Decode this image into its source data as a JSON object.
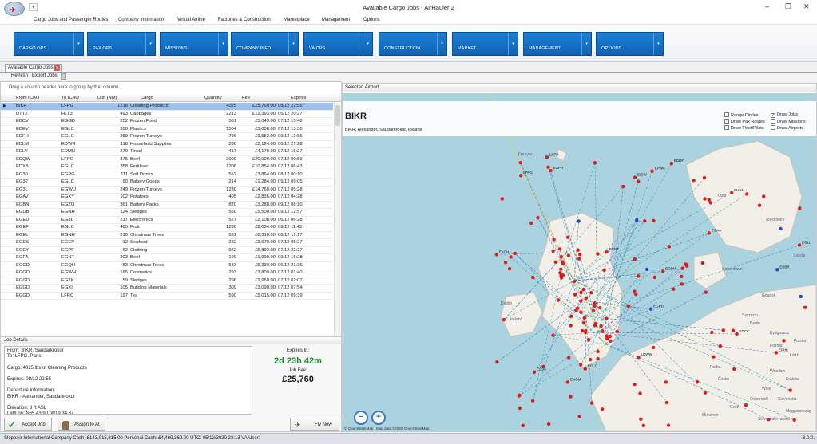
{
  "window": {
    "title": "Available Cargo Jobs - AirHauler 2",
    "qat_glyph": "▾",
    "orb_glyph": "✈",
    "controls": {
      "minimize": "–",
      "maximize": "❐",
      "close": "✕"
    }
  },
  "menubar": [
    "Cargo Jobs and Passenger Routes",
    "Company Information",
    "Virtual Airline",
    "Factories & Construction",
    "Marketplace",
    "Management",
    "Options"
  ],
  "ribbon": [
    "CARGO OPS",
    "PAX OPS",
    "MISSIONS",
    "COMPANY INFO",
    "VA OPS",
    "CONSTRUCTION",
    "MARKET",
    "MANAGEMENT",
    "OPTIONS"
  ],
  "ribbon_drop": "▾",
  "document_tab": {
    "label": "Available Cargo Jobs",
    "close": "x"
  },
  "toolbar": {
    "refresh": "Refresh",
    "export": "Export Jobs"
  },
  "grid": {
    "group_hint": "Drag a column header here to group by that column",
    "headers": {
      "from": "From ICAO",
      "to": "To ICAO",
      "dist": "Dist (NM)",
      "cargo": "Cargo",
      "qty": "Quantity",
      "fee": "Fee",
      "expires": "Expires"
    },
    "row_indicator": "▶",
    "rows": [
      {
        "from": "BIKR",
        "to": "LFPG",
        "dist": "1218",
        "cargo": "Cleaning Products",
        "qty": "4025",
        "fee": "£25,760.00",
        "exp": "08/12 22:55"
      },
      {
        "from": "DTTZ",
        "to": "HLT3",
        "dist": "493",
        "cargo": "Cabbages",
        "qty": "2213",
        "fee": "£12,393.00",
        "exp": "06/12 20:27"
      },
      {
        "from": "EBCV",
        "to": "EGGD",
        "dist": "252",
        "cargo": "Frozen Food",
        "qty": "561",
        "fee": "£5,049.00",
        "exp": "07/12 15:48"
      },
      {
        "from": "EDEV",
        "to": "EGLC",
        "dist": "330",
        "cargo": "Plastics",
        "qty": "1504",
        "fee": "£3,008.00",
        "exp": "07/12 13:30"
      },
      {
        "from": "EDFH",
        "to": "EGLC",
        "dist": "289",
        "cargo": "Frozen Turkeys",
        "qty": "796",
        "fee": "£9,552.00",
        "exp": "09/12 13:55"
      },
      {
        "from": "EDLM",
        "to": "EDWR",
        "dist": "118",
        "cargo": "Household Supplies",
        "qty": "236",
        "fee": "£2,124.00",
        "exp": "06/12 21:28"
      },
      {
        "from": "EDLV",
        "to": "EDMN",
        "dist": "270",
        "cargo": "Tinsel",
        "qty": "417",
        "fee": "£4,170.00",
        "exp": "07/12 15:27"
      },
      {
        "from": "EDQW",
        "to": "LFPG",
        "dist": "375",
        "cargo": "Beef",
        "qty": "2009",
        "fee": "£20,090.00",
        "exp": "07/12 00:59"
      },
      {
        "from": "EDXB",
        "to": "EGLC",
        "dist": "358",
        "cargo": "Fertiliser",
        "qty": "1206",
        "fee": "£10,854.00",
        "exp": "07/12 06:43"
      },
      {
        "from": "EG30",
        "to": "EGPG",
        "dist": "111",
        "cargo": "Soft Drinks",
        "qty": "552",
        "fee": "£3,864.00",
        "exp": "08/12 00:10"
      },
      {
        "from": "EG32",
        "to": "EGLC",
        "dist": "90",
        "cargo": "Bakery Goods",
        "qty": "214",
        "fee": "£1,284.00",
        "exp": "09/12 09:05"
      },
      {
        "from": "EG3L",
        "to": "EGWU",
        "dist": "249",
        "cargo": "Frozen Turkeys",
        "qty": "1230",
        "fee": "£14,760.00",
        "exp": "07/12 05:28"
      },
      {
        "from": "EGAV",
        "to": "EGXY",
        "dist": "102",
        "cargo": "Potatoes",
        "qty": "405",
        "fee": "£2,835.00",
        "exp": "07/12 04:28"
      },
      {
        "from": "EGBN",
        "to": "EGZQ",
        "dist": "361",
        "cargo": "Battery Packs",
        "qty": "820",
        "fee": "£3,280.00",
        "exp": "09/12 08:10"
      },
      {
        "from": "EGDB",
        "to": "EGNH",
        "dist": "124",
        "cargo": "Sledges",
        "qty": "550",
        "fee": "£5,500.00",
        "exp": "09/12 12:57"
      },
      {
        "from": "EGED",
        "to": "EG3L",
        "dist": "217",
        "cargo": "Electronics",
        "qty": "527",
        "fee": "£2,108.00",
        "exp": "06/12 06:28"
      },
      {
        "from": "EGEF",
        "to": "EGLC",
        "dist": "485",
        "cargo": "Fruit",
        "qty": "1236",
        "fee": "£8,034.00",
        "exp": "09/12 11:42"
      },
      {
        "from": "EGEL",
        "to": "EGNH",
        "dist": "210",
        "cargo": "Christmas Trees",
        "qty": "631",
        "fee": "£6,310.00",
        "exp": "08/12 19:17"
      },
      {
        "from": "EGES",
        "to": "EGEP",
        "dist": "12",
        "cargo": "Seafood",
        "qty": "282",
        "fee": "£2,679.00",
        "exp": "07/12 05:27"
      },
      {
        "from": "EGEY",
        "to": "EGPF",
        "dist": "62",
        "cargo": "Clothing",
        "qty": "982",
        "fee": "£5,892.00",
        "exp": "07/12 22:27"
      },
      {
        "from": "EGFA",
        "to": "EGNT",
        "dist": "203",
        "cargo": "Beef",
        "qty": "199",
        "fee": "£1,990.00",
        "exp": "09/12 15:28"
      },
      {
        "from": "EGGD",
        "to": "EGQH",
        "dist": "83",
        "cargo": "Christmas Trees",
        "qty": "533",
        "fee": "£5,330.00",
        "exp": "06/12 21:35"
      },
      {
        "from": "EGGD",
        "to": "EGWH",
        "dist": "165",
        "cargo": "Cosmetics",
        "qty": "293",
        "fee": "£3,809.00",
        "exp": "07/12 01:40"
      },
      {
        "from": "EGGD",
        "to": "EGTK",
        "dist": "59",
        "cargo": "Sledges",
        "qty": "296",
        "fee": "£2,960.00",
        "exp": "07/12 02:07"
      },
      {
        "from": "EGGD",
        "to": "EGXI",
        "dist": "105",
        "cargo": "Building Materials",
        "qty": "309",
        "fee": "£3,090.00",
        "exp": "07/12 07:54"
      },
      {
        "from": "EGGD",
        "to": "LFRC",
        "dist": "197",
        "cargo": "Tea",
        "qty": "590",
        "fee": "£5,015.00",
        "exp": "07/12 09:39"
      }
    ]
  },
  "job_details": {
    "header": "Job Details",
    "lines": [
      "From: BIKR, Saudarkrokur",
      "To: LFPG, Paris",
      "",
      "Cargo: 4025 lbs of Cleaning Products",
      "",
      "Expires: 08/12 22:55",
      "",
      "Departure Information:",
      "BIKR - Alexander, Saudarkrokur",
      "",
      "Elevation: 8 ft ASL",
      "Lat/Lon: N65 43.90  W19 34.37"
    ],
    "expires_label": "Expires In:",
    "expires_value": "2d 23h 42m",
    "fee_label": "Job Fee:",
    "fee_value": "£25,760",
    "accept": "Accept Job",
    "assign": "Assign to AI",
    "fly_now": "Fly Now"
  },
  "map": {
    "header": "Selected Airport",
    "icao": "BIKR",
    "name": "BIKR, Alexander, Saudarkrokur, Iceland",
    "options": [
      {
        "label": "Range Circles",
        "checked": false
      },
      {
        "label": "Draw Jobs",
        "checked": true
      },
      {
        "label": "Draw Pax Routes",
        "checked": false
      },
      {
        "label": "Draw Missions",
        "checked": false
      },
      {
        "label": "Draw Fleet/Pilots",
        "checked": false
      },
      {
        "label": "Draw Airports",
        "checked": false
      }
    ],
    "attribution": "© OpenStreetMap | Map data ©2020 OpenStreetMap",
    "zoom_out": "−",
    "zoom_in": "+",
    "place_labels": [
      "Føroyar",
      "Oslo",
      "Stockholm",
      "København",
      "Ireland",
      "Berlin",
      "Szczecin",
      "Bydgoszcz",
      "Poznań",
      "Polska",
      "Łódź",
      "Wrocław",
      "Kraków",
      "Praha",
      "Česko",
      "Slovensko",
      "Österreich",
      "Magyarország",
      "Wien",
      "Graz",
      "Hrvatska",
      "Slovenija",
      "München",
      "Dublin",
      "Gdańsk",
      "Latvija"
    ],
    "airport_labels": [
      "EGPD",
      "EGLC",
      "EGPH",
      "EGAA",
      "EGNT",
      "EGCC",
      "EGLL",
      "EHAM",
      "EDDF",
      "EKCH",
      "ESSA",
      "ENGM",
      "EPWA",
      "LKPR",
      "LOWW",
      "LFPG",
      "EDDM",
      "EBBR",
      "EIDW",
      "EFHK"
    ]
  },
  "statusbar": {
    "text": "SlopeAir International   Company Cash: £143,015,815.00   Personal Cash: £4,469,369.00   UTC: 05/12/2020  23:13   VA User:",
    "version": "3.0.0."
  }
}
